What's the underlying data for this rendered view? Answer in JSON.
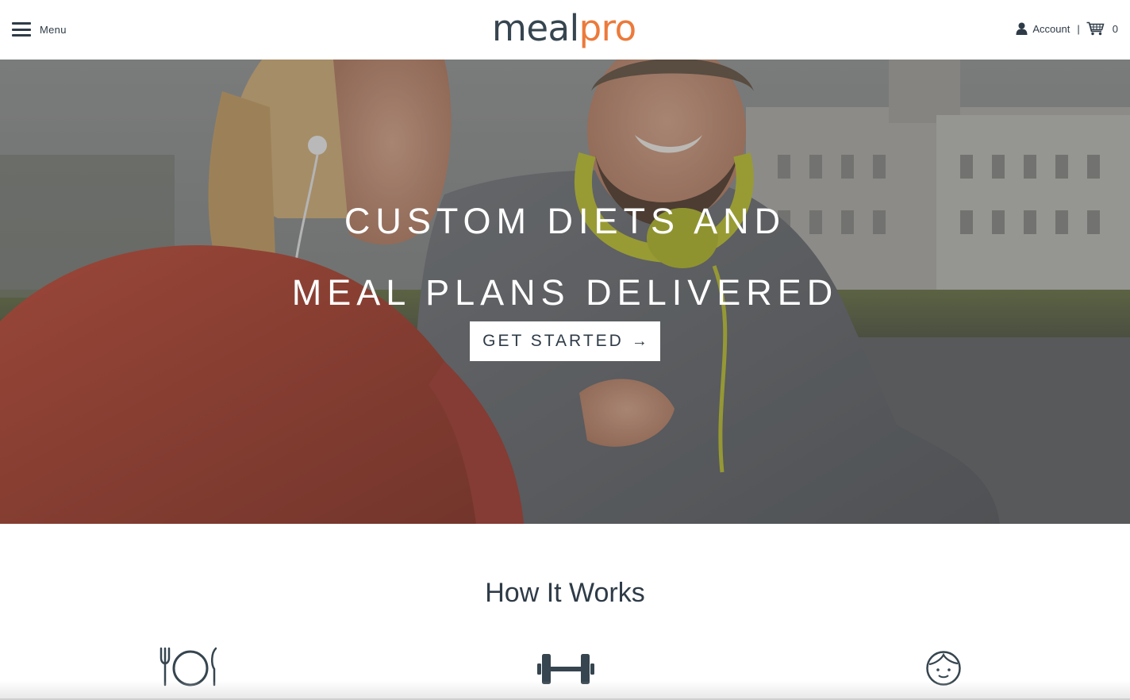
{
  "header": {
    "menu_label": "Menu",
    "logo": {
      "part1": "meal",
      "part2": "pro"
    },
    "account_label": "Account",
    "separator": "|",
    "cart_count": "0",
    "icons": {
      "menu": "hamburger-icon",
      "account": "user-icon",
      "cart": "shopping-cart-icon"
    }
  },
  "hero": {
    "title_line1": "CUSTOM DIETS AND",
    "title_line2": "MEAL PLANS DELIVERED",
    "cta_label": "GET STARTED",
    "cta_arrow": "→"
  },
  "how_it_works": {
    "title": "How It Works",
    "steps": [
      {
        "icon": "plate-fork-knife-icon"
      },
      {
        "icon": "dumbbell-icon"
      },
      {
        "icon": "smiling-face-icon"
      }
    ]
  },
  "colors": {
    "text_dark": "#2e3b47",
    "logo_dark": "#36454f",
    "logo_accent": "#ec7a3b",
    "cta_background": "#ffffff"
  }
}
